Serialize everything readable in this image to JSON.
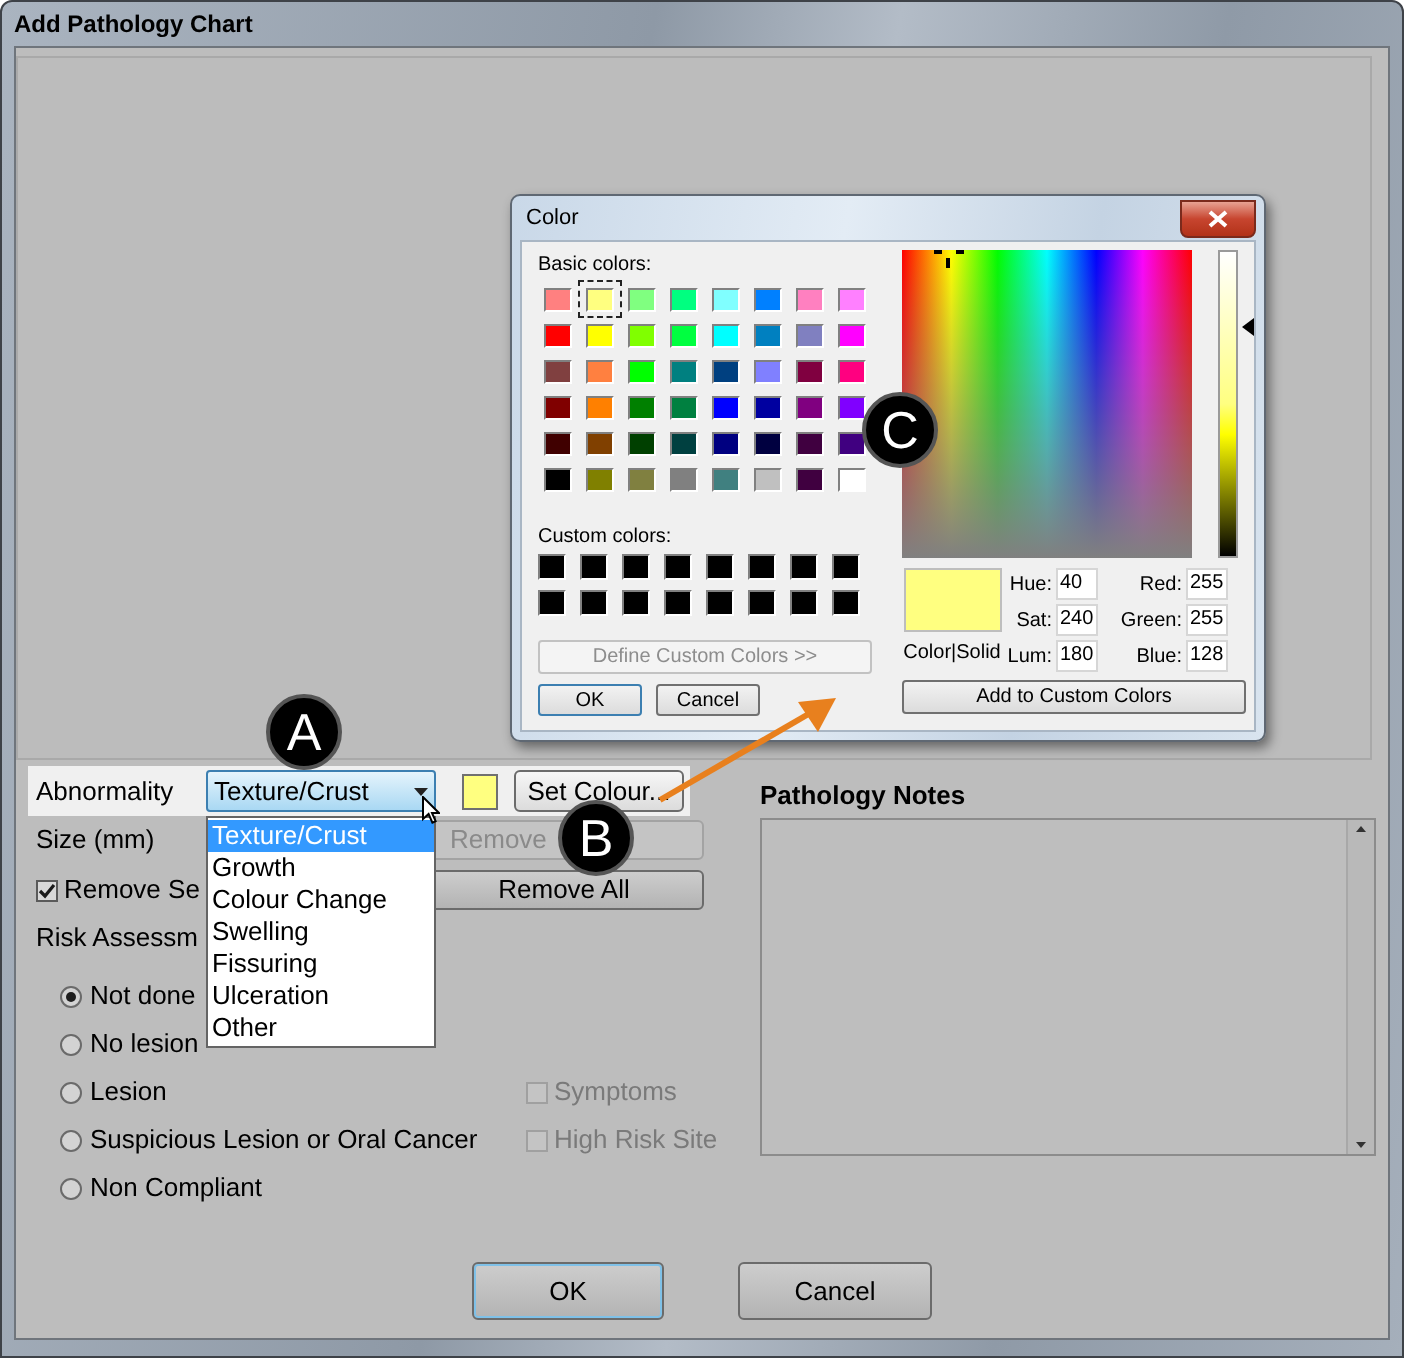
{
  "window": {
    "title": "Add Pathology Chart"
  },
  "abnormality": {
    "label": "Abnormality",
    "value": "Texture/Crust",
    "expanded": true,
    "options": [
      {
        "label": "Texture/Crust",
        "selected": true
      },
      {
        "label": "Growth",
        "selected": false
      },
      {
        "label": "Colour Change",
        "selected": false
      },
      {
        "label": "Swelling",
        "selected": false
      },
      {
        "label": "Fissuring",
        "selected": false
      },
      {
        "label": "Ulceration",
        "selected": false
      },
      {
        "label": "Other",
        "selected": false
      }
    ],
    "swatch": {
      "color": "#ffff80"
    },
    "set_colour_button": "Set Colour..."
  },
  "size": {
    "label": "Size (mm)",
    "remove_button": {
      "label": "Remove",
      "disabled": true
    }
  },
  "remove_checkbox": {
    "label": "Remove Se",
    "checked": true
  },
  "remove_all_button": {
    "label": "Remove All",
    "disabled": false
  },
  "risk_assessment": {
    "label": "Risk Assessm",
    "options": [
      {
        "label": "Not done",
        "selected": true
      },
      {
        "label": "No lesion",
        "selected": false
      },
      {
        "label": "Lesion",
        "selected": false
      },
      {
        "label": "Suspicious Lesion or Oral Cancer",
        "selected": false
      },
      {
        "label": "Non Compliant",
        "selected": false
      }
    ]
  },
  "flags": [
    {
      "label": "Symptoms",
      "checked": false,
      "disabled": true
    },
    {
      "label": "High Risk Site",
      "checked": false,
      "disabled": true
    }
  ],
  "pathology_notes": {
    "label": "Pathology Notes"
  },
  "buttons": [
    {
      "label": "OK",
      "default": true
    },
    {
      "label": "Cancel",
      "default": false
    }
  ],
  "color_dialog": {
    "title": "Color",
    "basic_label": "Basic colors:",
    "basic_colors": [
      {
        "color": "#ff8080",
        "selected": false
      },
      {
        "color": "#ffff80",
        "selected": true
      },
      {
        "color": "#80ff80",
        "selected": false
      },
      {
        "color": "#00ff80",
        "selected": false
      },
      {
        "color": "#80ffff",
        "selected": false
      },
      {
        "color": "#0080ff",
        "selected": false
      },
      {
        "color": "#ff80c0",
        "selected": false
      },
      {
        "color": "#ff80ff",
        "selected": false
      },
      {
        "color": "#ff0000",
        "selected": false
      },
      {
        "color": "#ffff00",
        "selected": false
      },
      {
        "color": "#80ff00",
        "selected": false
      },
      {
        "color": "#00ff40",
        "selected": false
      },
      {
        "color": "#00ffff",
        "selected": false
      },
      {
        "color": "#0080c0",
        "selected": false
      },
      {
        "color": "#8080c0",
        "selected": false
      },
      {
        "color": "#ff00ff",
        "selected": false
      },
      {
        "color": "#804040",
        "selected": false
      },
      {
        "color": "#ff8040",
        "selected": false
      },
      {
        "color": "#00ff00",
        "selected": false
      },
      {
        "color": "#008080",
        "selected": false
      },
      {
        "color": "#004080",
        "selected": false
      },
      {
        "color": "#8080ff",
        "selected": false
      },
      {
        "color": "#800040",
        "selected": false
      },
      {
        "color": "#ff0080",
        "selected": false
      },
      {
        "color": "#800000",
        "selected": false
      },
      {
        "color": "#ff8000",
        "selected": false
      },
      {
        "color": "#008000",
        "selected": false
      },
      {
        "color": "#008040",
        "selected": false
      },
      {
        "color": "#0000ff",
        "selected": false
      },
      {
        "color": "#0000a0",
        "selected": false
      },
      {
        "color": "#800080",
        "selected": false
      },
      {
        "color": "#8000ff",
        "selected": false
      },
      {
        "color": "#400000",
        "selected": false
      },
      {
        "color": "#804000",
        "selected": false
      },
      {
        "color": "#004000",
        "selected": false
      },
      {
        "color": "#004040",
        "selected": false
      },
      {
        "color": "#000080",
        "selected": false
      },
      {
        "color": "#000040",
        "selected": false
      },
      {
        "color": "#400040",
        "selected": false
      },
      {
        "color": "#400080",
        "selected": false
      },
      {
        "color": "#000000",
        "selected": false
      },
      {
        "color": "#808000",
        "selected": false
      },
      {
        "color": "#808040",
        "selected": false
      },
      {
        "color": "#808080",
        "selected": false
      },
      {
        "color": "#408080",
        "selected": false
      },
      {
        "color": "#c0c0c0",
        "selected": false
      },
      {
        "color": "#400040",
        "selected": false
      },
      {
        "color": "#ffffff",
        "selected": false
      }
    ],
    "custom_label": "Custom colors:",
    "custom_colors": [
      {
        "color": "#000000"
      },
      {
        "color": "#000000"
      },
      {
        "color": "#000000"
      },
      {
        "color": "#000000"
      },
      {
        "color": "#000000"
      },
      {
        "color": "#000000"
      },
      {
        "color": "#000000"
      },
      {
        "color": "#000000"
      },
      {
        "color": "#000000"
      },
      {
        "color": "#000000"
      },
      {
        "color": "#000000"
      },
      {
        "color": "#000000"
      },
      {
        "color": "#000000"
      },
      {
        "color": "#000000"
      },
      {
        "color": "#000000"
      },
      {
        "color": "#000000"
      }
    ],
    "define_button": {
      "label": "Define Custom Colors >>",
      "disabled": true
    },
    "ok_button": "OK",
    "cancel_button": "Cancel",
    "luminance": {
      "level": 0.75
    },
    "preview": {
      "label": "Color|Solid",
      "color": "#ffff80"
    },
    "fields_left": [
      {
        "label": "Hue:",
        "value": "40"
      },
      {
        "label": "Sat:",
        "value": "240"
      },
      {
        "label": "Lum:",
        "value": "180"
      }
    ],
    "fields_right": [
      {
        "label": "Red:",
        "value": "255"
      },
      {
        "label": "Green:",
        "value": "255"
      },
      {
        "label": "Blue:",
        "value": "128"
      }
    ],
    "add_button": "Add to Custom Colors"
  },
  "callouts": [
    {
      "label": "A"
    },
    {
      "label": "B"
    },
    {
      "label": "C"
    }
  ]
}
